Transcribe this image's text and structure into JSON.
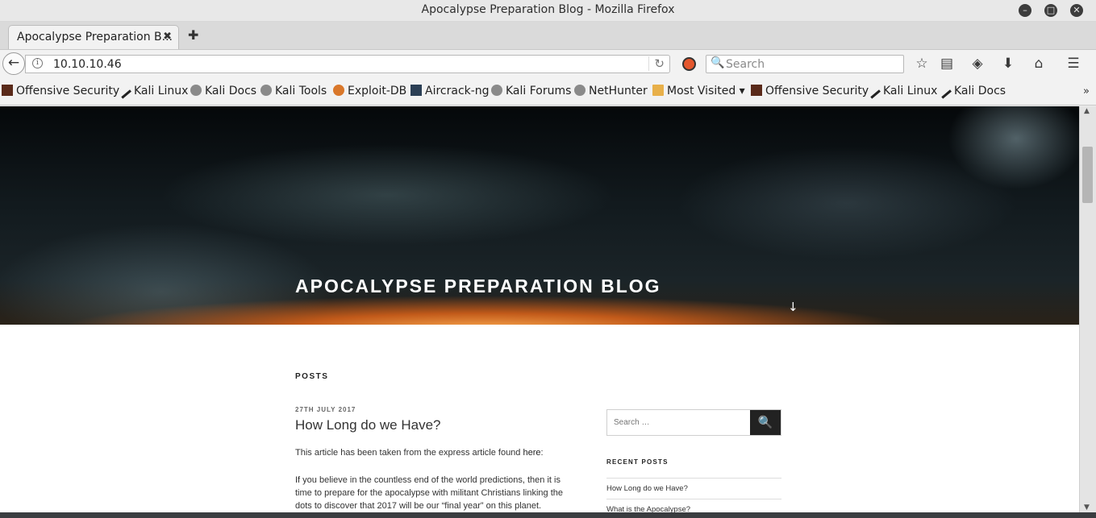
{
  "window": {
    "title": "Apocalypse Preparation Blog - Mozilla Firefox"
  },
  "tabs": [
    {
      "label": "Apocalypse Preparation B...",
      "close": "✖"
    }
  ],
  "new_tab": "✚",
  "navbar": {
    "back": "←",
    "url": "10.10.10.46",
    "info": "i",
    "reload": "↻",
    "search_placeholder": "Search",
    "search_icon": "🔍"
  },
  "toolbar_icons": {
    "bookmark_star": "☆",
    "reading_list": "▤",
    "pocket": "◈",
    "downloads": "⬇",
    "home": "⌂",
    "menu": "☰"
  },
  "bookmarks": [
    {
      "label": "Offensive Security",
      "icon": "offsec-icon"
    },
    {
      "label": "Kali Linux",
      "icon": "kali-icon"
    },
    {
      "label": "Kali Docs",
      "icon": "globe-icon"
    },
    {
      "label": "Kali Tools",
      "icon": "globe-icon"
    },
    {
      "label": "Exploit-DB",
      "icon": "exploitdb-icon"
    },
    {
      "label": "Aircrack-ng",
      "icon": "aircrack-icon"
    },
    {
      "label": "Kali Forums",
      "icon": "globe-icon"
    },
    {
      "label": "NetHunter",
      "icon": "globe-icon"
    },
    {
      "label": "Most Visited ▾",
      "icon": "folder-icon"
    },
    {
      "label": "Offensive Security",
      "icon": "offsec-icon"
    },
    {
      "label": "Kali Linux",
      "icon": "kali-icon"
    },
    {
      "label": "Kali Docs",
      "icon": "kali-icon"
    }
  ],
  "bookmarks_overflow": "»",
  "page": {
    "blog_title": "APOCALYPSE PREPARATION BLOG",
    "down_arrow": "↓",
    "posts_heading": "POSTS",
    "post": {
      "date": "27TH JULY 2017",
      "title": "How Long do we Have?",
      "p1_text": "This article has been taken from the express article found ",
      "p1_link": "here",
      "p1_end": ":",
      "p2": "If you believe in the countless end of the world predictions, then it is time to prepare for the apocalypse with militant Christians linking the dots to discover that 2017 will be our “final year” on this planet."
    },
    "sidebar": {
      "search_placeholder": "Search …",
      "search_button": "🔍",
      "recent_heading": "RECENT POSTS",
      "recent_posts": [
        "How Long do we Have?",
        "What is the Apocalypse?"
      ]
    }
  },
  "scrollbar": {
    "up": "▲",
    "down": "▼"
  }
}
